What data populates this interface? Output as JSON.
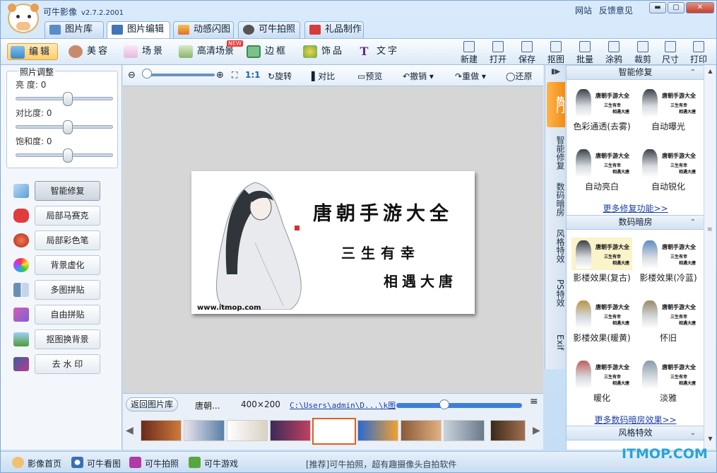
{
  "app": {
    "title": "可牛影像",
    "version": "v2.7.2.2001",
    "links": [
      "网站",
      "反馈意见"
    ]
  },
  "window_controls": {
    "minimize": "▬",
    "maximize": "▢",
    "close": "✕"
  },
  "tabs": [
    {
      "label": "图片库",
      "active": false
    },
    {
      "label": "图片编辑",
      "active": true
    },
    {
      "label": "动感闪图",
      "active": false
    },
    {
      "label": "可牛拍照",
      "active": false
    },
    {
      "label": "礼品制作",
      "active": false
    }
  ],
  "modes": [
    {
      "label": "编辑",
      "active": true
    },
    {
      "label": "美容",
      "active": false
    },
    {
      "label": "场景",
      "active": false
    },
    {
      "label": "高清场景",
      "active": false,
      "badge": "NEW"
    },
    {
      "label": "边框",
      "active": false
    },
    {
      "label": "饰品",
      "active": false
    },
    {
      "label": "文字",
      "active": false
    }
  ],
  "file_tools": [
    "新建",
    "打开",
    "保存",
    "抠图",
    "批量",
    "涂鸦",
    "裁剪",
    "尺寸",
    "打印"
  ],
  "adjust": {
    "title": "照片调整",
    "brightness": {
      "label": "亮  度:",
      "value": "0"
    },
    "contrast": {
      "label": "对比度:",
      "value": "0"
    },
    "saturation": {
      "label": "饱和度:",
      "value": "0"
    }
  },
  "tools": [
    "智能修复",
    "局部马赛克",
    "局部彩色笔",
    "背景虚化",
    "多图拼贴",
    "自由拼贴",
    "抠图换背景",
    "去 水 印"
  ],
  "editbar": {
    "zoom_ratio": "1:1",
    "rotate": "旋转",
    "compare": "对比",
    "preview": "预览",
    "undo": "撤销",
    "redo": "重做",
    "restore": "还原"
  },
  "photo": {
    "line1": "唐朝手游大全",
    "line2": "三生有幸",
    "line3": "相遇大唐",
    "url": "www.itmop.com"
  },
  "strip": {
    "back": "返回图片库",
    "name": "唐朝...",
    "size": "400×200",
    "path": "C:\\Users\\admin\\D...\\k图"
  },
  "side_tabs": [
    "热门",
    "智能修复",
    "数码暗房",
    "风格特效",
    "PS特效",
    "Exif"
  ],
  "smart_fix": {
    "title": "智能修复",
    "items": [
      "色彩通透(去雾)",
      "自动曝光",
      "自动亮白",
      "自动锐化"
    ],
    "more": "更多修复功能>>"
  },
  "darkroom": {
    "title": "数码暗房",
    "items": [
      "影楼效果(复古)",
      "影楼效果(冷蓝)",
      "影楼效果(暖黄)",
      "怀旧",
      "暖化",
      "淡雅"
    ],
    "more": "更多数码暗房效果>>"
  },
  "style_fx": {
    "title": "风格特效"
  },
  "mini_thumb": {
    "l1": "唐朝手游大全",
    "l2": "三生有幸",
    "l3": "相遇大唐"
  },
  "status": {
    "items": [
      "影像首页",
      "可牛看图",
      "可牛拍照",
      "可牛游戏"
    ],
    "middle": "[推荐]可牛拍照，超有趣摄像头自拍软件"
  },
  "watermark": "ITMOP.COM"
}
